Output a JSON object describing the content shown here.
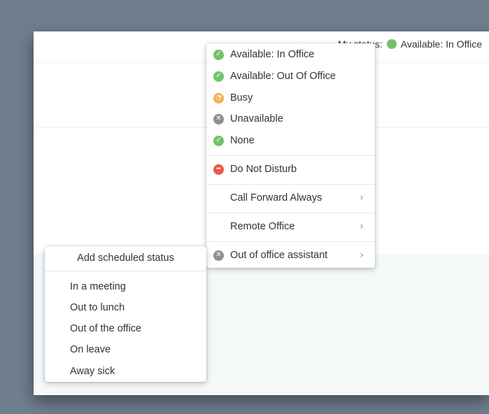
{
  "header": {
    "my_status_label": "My status:",
    "current_status": "Available: In Office"
  },
  "status_menu": {
    "items": [
      {
        "label": "Available: In Office",
        "icon": "check-circle-icon",
        "color": "#73c26a"
      },
      {
        "label": "Available: Out Of Office",
        "icon": "check-circle-icon",
        "color": "#73c26a"
      },
      {
        "label": "Busy",
        "icon": "clock-icon",
        "color": "#f2b04a"
      },
      {
        "label": "Unavailable",
        "icon": "x-circle-icon",
        "color": "#8a8f94"
      },
      {
        "label": "None",
        "icon": "check-circle-icon",
        "color": "#73c26a"
      }
    ],
    "dnd": {
      "label": "Do Not Disturb",
      "icon": "minus-circle-icon",
      "color": "#e8584a"
    },
    "submenus": [
      {
        "label": "Call Forward Always",
        "icon": "phone-forward-icon"
      },
      {
        "label": "Remote Office",
        "icon": "remote-office-icon"
      },
      {
        "label": "Out of office assistant",
        "icon": "x-circle-icon"
      }
    ]
  },
  "schedule_menu": {
    "header": "Add scheduled status",
    "items": [
      "In a meeting",
      "Out to lunch",
      "Out of the office",
      "On leave",
      "Away sick"
    ]
  },
  "colors": {
    "accent": "#29a9e3",
    "available": "#73c26a",
    "busy": "#f2b04a",
    "unavailable": "#8a8f94",
    "dnd": "#e8584a"
  }
}
